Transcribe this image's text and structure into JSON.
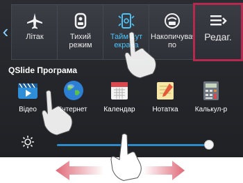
{
  "quick_settings": [
    {
      "label": "Літак",
      "icon": "airplane-icon"
    },
    {
      "label": "Тихий режим",
      "icon": "silent-mode-icon"
    },
    {
      "label": "Тайм-аут екрана",
      "icon": "screen-timeout-icon"
    },
    {
      "label": "Накопичувач по",
      "icon": "storage-icon"
    }
  ],
  "edit_button": {
    "label": "Редаг.",
    "icon": "edit-list-icon"
  },
  "qslide": {
    "title": "QSlide Програма",
    "apps": [
      {
        "label": "Відео",
        "icon": "video-icon"
      },
      {
        "label": "Інтернет",
        "icon": "globe-icon"
      },
      {
        "label": "Календар",
        "icon": "calendar-icon"
      },
      {
        "label": "Нотатка",
        "icon": "memo-icon"
      },
      {
        "label": "Калькул-р",
        "icon": "calculator-icon"
      }
    ]
  },
  "brightness": {
    "level": 0.97,
    "icon": "brightness-icon"
  },
  "colors": {
    "accent": "#4fc3f7",
    "edit_border": "#b5294f",
    "arrow": "#e06a78"
  }
}
